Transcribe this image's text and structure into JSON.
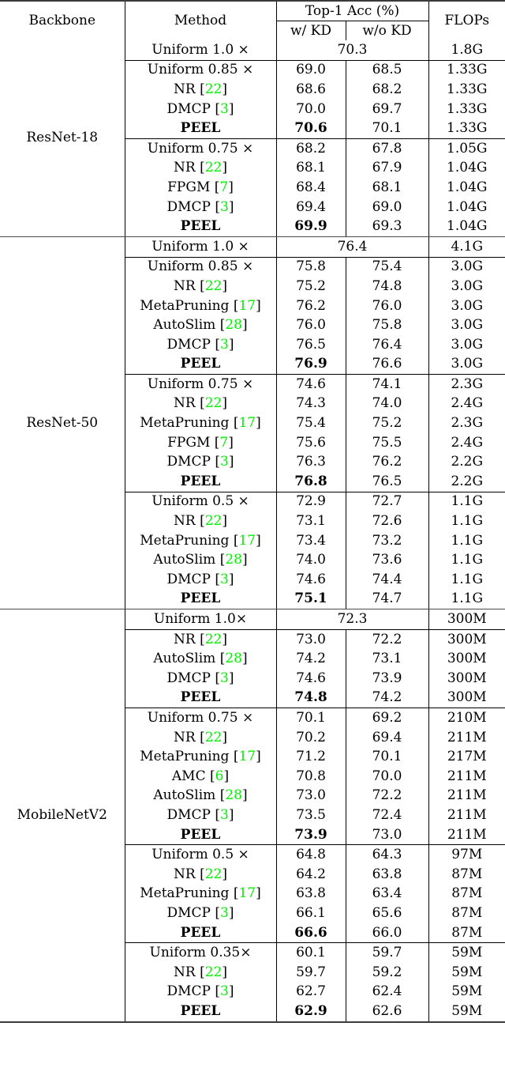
{
  "table": {
    "headers": {
      "backbone": "Backbone",
      "method": "Method",
      "acc_group": "Top-1  Acc (%)",
      "acc_kd": "w/ KD",
      "acc_nokd": "w/o KD",
      "flops": "FLOPs"
    },
    "colors": {
      "citation": "#00f200",
      "rule": "#000000"
    },
    "sections": [
      {
        "backbone": "ResNet-18",
        "groups": [
          {
            "rows": [
              {
                "method": "Uniform 1.0 ×",
                "cite": "",
                "merged": true,
                "acc": "70.3",
                "kd": "",
                "nokd": "",
                "flops": "1.8G",
                "bold": false
              }
            ]
          },
          {
            "rows": [
              {
                "method": "Uniform 0.85 ×",
                "cite": "",
                "merged": false,
                "kd": "69.0",
                "nokd": "68.5",
                "flops": "1.33G",
                "bold": false
              },
              {
                "method": "NR",
                "cite": "22",
                "merged": false,
                "kd": "68.6",
                "nokd": "68.2",
                "flops": "1.33G",
                "bold": false
              },
              {
                "method": "DMCP",
                "cite": "3",
                "merged": false,
                "kd": "70.0",
                "nokd": "69.7",
                "flops": "1.33G",
                "bold": false
              },
              {
                "method": "PEEL",
                "cite": "",
                "merged": false,
                "kd": "70.6",
                "nokd": "70.1",
                "flops": "1.33G",
                "bold": true
              }
            ]
          },
          {
            "rows": [
              {
                "method": "Uniform 0.75 ×",
                "cite": "",
                "merged": false,
                "kd": "68.2",
                "nokd": "67.8",
                "flops": "1.05G",
                "bold": false
              },
              {
                "method": "NR",
                "cite": "22",
                "merged": false,
                "kd": "68.1",
                "nokd": "67.9",
                "flops": "1.04G",
                "bold": false
              },
              {
                "method": "FPGM",
                "cite": "7",
                "merged": false,
                "kd": "68.4",
                "nokd": "68.1",
                "flops": "1.04G",
                "bold": false
              },
              {
                "method": "DMCP",
                "cite": "3",
                "merged": false,
                "kd": "69.4",
                "nokd": "69.0",
                "flops": "1.04G",
                "bold": false
              },
              {
                "method": "PEEL",
                "cite": "",
                "merged": false,
                "kd": "69.9",
                "nokd": "69.3",
                "flops": "1.04G",
                "bold": true
              }
            ]
          }
        ]
      },
      {
        "backbone": "ResNet-50",
        "groups": [
          {
            "rows": [
              {
                "method": "Uniform 1.0 ×",
                "cite": "",
                "merged": true,
                "acc": "76.4",
                "kd": "",
                "nokd": "",
                "flops": "4.1G",
                "bold": false
              }
            ]
          },
          {
            "rows": [
              {
                "method": "Uniform 0.85 ×",
                "cite": "",
                "merged": false,
                "kd": "75.8",
                "nokd": "75.4",
                "flops": "3.0G",
                "bold": false
              },
              {
                "method": "NR",
                "cite": "22",
                "merged": false,
                "kd": "75.2",
                "nokd": "74.8",
                "flops": "3.0G",
                "bold": false
              },
              {
                "method": "MetaPruning",
                "cite": "17",
                "merged": false,
                "kd": "76.2",
                "nokd": "76.0",
                "flops": "3.0G",
                "bold": false
              },
              {
                "method": "AutoSlim",
                "cite": "28",
                "merged": false,
                "kd": "76.0",
                "nokd": "75.8",
                "flops": "3.0G",
                "bold": false
              },
              {
                "method": "DMCP",
                "cite": "3",
                "merged": false,
                "kd": "76.5",
                "nokd": "76.4",
                "flops": "3.0G",
                "bold": false
              },
              {
                "method": "PEEL",
                "cite": "",
                "merged": false,
                "kd": "76.9",
                "nokd": "76.6",
                "flops": "3.0G",
                "bold": true
              }
            ]
          },
          {
            "rows": [
              {
                "method": "Uniform 0.75 ×",
                "cite": "",
                "merged": false,
                "kd": "74.6",
                "nokd": "74.1",
                "flops": "2.3G",
                "bold": false
              },
              {
                "method": "NR",
                "cite": "22",
                "merged": false,
                "kd": "74.3",
                "nokd": "74.0",
                "flops": "2.4G",
                "bold": false
              },
              {
                "method": "MetaPruning",
                "cite": "17",
                "merged": false,
                "kd": "75.4",
                "nokd": "75.2",
                "flops": "2.3G",
                "bold": false
              },
              {
                "method": "FPGM",
                "cite": "7",
                "merged": false,
                "kd": "75.6",
                "nokd": "75.5",
                "flops": "2.4G",
                "bold": false
              },
              {
                "method": "DMCP",
                "cite": "3",
                "merged": false,
                "kd": "76.3",
                "nokd": "76.2",
                "flops": "2.2G",
                "bold": false
              },
              {
                "method": "PEEL",
                "cite": "",
                "merged": false,
                "kd": "76.8",
                "nokd": "76.5",
                "flops": "2.2G",
                "bold": true
              }
            ]
          },
          {
            "rows": [
              {
                "method": "Uniform 0.5 ×",
                "cite": "",
                "merged": false,
                "kd": "72.9",
                "nokd": "72.7",
                "flops": "1.1G",
                "bold": false
              },
              {
                "method": "NR",
                "cite": "22",
                "merged": false,
                "kd": "73.1",
                "nokd": "72.6",
                "flops": "1.1G",
                "bold": false
              },
              {
                "method": "MetaPruning",
                "cite": "17",
                "merged": false,
                "kd": "73.4",
                "nokd": "73.2",
                "flops": "1.1G",
                "bold": false
              },
              {
                "method": "AutoSlim",
                "cite": "28",
                "merged": false,
                "kd": "74.0",
                "nokd": "73.6",
                "flops": "1.1G",
                "bold": false
              },
              {
                "method": "DMCP",
                "cite": "3",
                "merged": false,
                "kd": "74.6",
                "nokd": "74.4",
                "flops": "1.1G",
                "bold": false
              },
              {
                "method": "PEEL",
                "cite": "",
                "merged": false,
                "kd": "75.1",
                "nokd": "74.7",
                "flops": "1.1G",
                "bold": true
              }
            ]
          }
        ]
      },
      {
        "backbone": "MobileNetV2",
        "groups": [
          {
            "rows": [
              {
                "method": "Uniform 1.0×",
                "cite": "",
                "merged": true,
                "acc": "72.3",
                "kd": "",
                "nokd": "",
                "flops": "300M",
                "bold": false
              }
            ]
          },
          {
            "rows": [
              {
                "method": "NR",
                "cite": "22",
                "merged": false,
                "kd": "73.0",
                "nokd": "72.2",
                "flops": "300M",
                "bold": false
              },
              {
                "method": "AutoSlim",
                "cite": "28",
                "merged": false,
                "kd": "74.2",
                "nokd": "73.1",
                "flops": "300M",
                "bold": false
              },
              {
                "method": "DMCP",
                "cite": "3",
                "merged": false,
                "kd": "74.6",
                "nokd": "73.9",
                "flops": "300M",
                "bold": false
              },
              {
                "method": "PEEL",
                "cite": "",
                "merged": false,
                "kd": "74.8",
                "nokd": "74.2",
                "flops": "300M",
                "bold": true
              }
            ]
          },
          {
            "rows": [
              {
                "method": "Uniform 0.75 ×",
                "cite": "",
                "merged": false,
                "kd": "70.1",
                "nokd": "69.2",
                "flops": "210M",
                "bold": false
              },
              {
                "method": "NR",
                "cite": "22",
                "merged": false,
                "kd": "70.2",
                "nokd": "69.4",
                "flops": "211M",
                "bold": false
              },
              {
                "method": "MetaPruning",
                "cite": "17",
                "merged": false,
                "kd": "71.2",
                "nokd": "70.1",
                "flops": "217M",
                "bold": false
              },
              {
                "method": "AMC",
                "cite": "6",
                "merged": false,
                "kd": "70.8",
                "nokd": "70.0",
                "flops": "211M",
                "bold": false
              },
              {
                "method": "AutoSlim",
                "cite": "28",
                "merged": false,
                "kd": "73.0",
                "nokd": "72.2",
                "flops": "211M",
                "bold": false
              },
              {
                "method": "DMCP",
                "cite": "3",
                "merged": false,
                "kd": "73.5",
                "nokd": "72.4",
                "flops": "211M",
                "bold": false
              },
              {
                "method": "PEEL",
                "cite": "",
                "merged": false,
                "kd": "73.9",
                "nokd": "73.0",
                "flops": "211M",
                "bold": true
              }
            ]
          },
          {
            "rows": [
              {
                "method": "Uniform 0.5 ×",
                "cite": "",
                "merged": false,
                "kd": "64.8",
                "nokd": "64.3",
                "flops": "97M",
                "bold": false
              },
              {
                "method": "NR",
                "cite": "22",
                "merged": false,
                "kd": "64.2",
                "nokd": "63.8",
                "flops": "87M",
                "bold": false
              },
              {
                "method": "MetaPruning",
                "cite": "17",
                "merged": false,
                "kd": "63.8",
                "nokd": "63.4",
                "flops": "87M",
                "bold": false
              },
              {
                "method": "DMCP",
                "cite": "3",
                "merged": false,
                "kd": "66.1",
                "nokd": "65.6",
                "flops": "87M",
                "bold": false
              },
              {
                "method": "PEEL",
                "cite": "",
                "merged": false,
                "kd": "66.6",
                "nokd": "66.0",
                "flops": "87M",
                "bold": true
              }
            ]
          },
          {
            "rows": [
              {
                "method": "Uniform 0.35×",
                "cite": "",
                "merged": false,
                "kd": "60.1",
                "nokd": "59.7",
                "flops": "59M",
                "bold": false
              },
              {
                "method": "NR",
                "cite": "22",
                "merged": false,
                "kd": "59.7",
                "nokd": "59.2",
                "flops": "59M",
                "bold": false
              },
              {
                "method": "DMCP",
                "cite": "3",
                "merged": false,
                "kd": "62.7",
                "nokd": "62.4",
                "flops": "59M",
                "bold": false
              },
              {
                "method": "PEEL",
                "cite": "",
                "merged": false,
                "kd": "62.9",
                "nokd": "62.6",
                "flops": "59M",
                "bold": true
              }
            ]
          }
        ]
      }
    ]
  }
}
